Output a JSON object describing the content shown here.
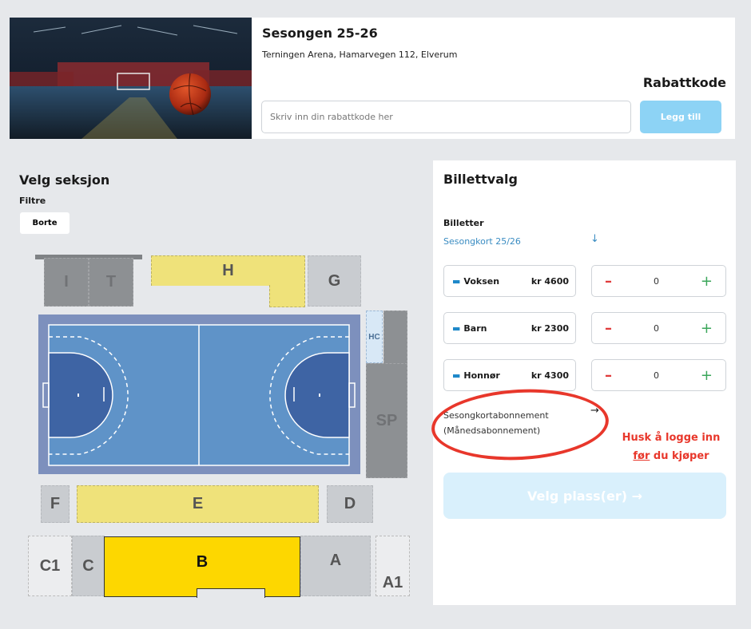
{
  "event": {
    "title": "Sesongen 25-26",
    "venue": "Terningen Arena, Hamarvegen 112, Elverum",
    "image_icon": "handball-arena-photo"
  },
  "discount": {
    "title": "Rabattkode",
    "placeholder": "Skriv inn din rabattkode her",
    "button": "Legg till"
  },
  "section": {
    "title": "Velg seksjon",
    "filters_label": "Filtre",
    "filter_chip": "Borte"
  },
  "arena_map": {
    "zones": [
      "I",
      "T",
      "H",
      "G",
      "HC",
      "SP",
      "F",
      "E",
      "D",
      "C1",
      "C",
      "B",
      "A",
      "A1"
    ],
    "selected_zone": "B",
    "colors": {
      "court": "#5f93c8",
      "court_surround": "#7d90bd",
      "goal_area": "#3e64a4",
      "selected": "#fdd700",
      "yellow": "#efe27a",
      "grey": "#c9ccd0",
      "dark_grey": "#8d9093"
    }
  },
  "ticket_panel": {
    "title": "Billettvalg",
    "billetter_label": "Billetter",
    "season_link": "Sesongkort 25/26",
    "tickets": [
      {
        "name": "Voksen",
        "price": "kr 4600",
        "qty": "0",
        "icon": "ticket-icon"
      },
      {
        "name": "Barn",
        "price": "kr 2300",
        "qty": "0",
        "icon": "ticket-icon"
      },
      {
        "name": "Honnør",
        "price": "kr 4300",
        "qty": "0",
        "icon": "ticket-icon"
      }
    ],
    "minus_label": "–",
    "plus_label": "+",
    "subscription_line1": "Sesongkortabonnement",
    "subscription_line2": "(Månedsabonnement)",
    "login_note_part1": "Husk å logge inn",
    "login_note_underlined": "før",
    "login_note_part2": " du kjøper",
    "select_button": "Velg plass(er) →",
    "accent_color": "#e8372b"
  }
}
